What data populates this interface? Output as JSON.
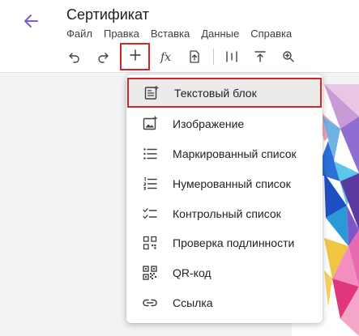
{
  "header": {
    "title": "Сертификат",
    "menu": [
      "Файл",
      "Правка",
      "Вставка",
      "Данные",
      "Справка"
    ]
  },
  "toolbar": {
    "buttons": [
      "undo-icon",
      "redo-icon",
      "plus-icon",
      "function-icon",
      "upload-icon",
      "align-icon",
      "align-top-icon",
      "zoom-icon"
    ]
  },
  "insert_menu": {
    "items": [
      {
        "label": "Текстовый блок",
        "icon": "text-block-icon"
      },
      {
        "label": "Изображение",
        "icon": "image-icon"
      },
      {
        "label": "Маркированный список",
        "icon": "bullet-list-icon"
      },
      {
        "label": "Нумерованный список",
        "icon": "numbered-list-icon"
      },
      {
        "label": "Контрольный список",
        "icon": "checklist-icon"
      },
      {
        "label": "Проверка подлинности",
        "icon": "verification-icon"
      },
      {
        "label": "QR-код",
        "icon": "qr-code-icon"
      },
      {
        "label": "Ссылка",
        "icon": "link-icon"
      }
    ]
  },
  "colors": {
    "accent": "#7b5cd6",
    "highlight_border": "#d4262a",
    "highlight_bg": "#ebebeb"
  }
}
